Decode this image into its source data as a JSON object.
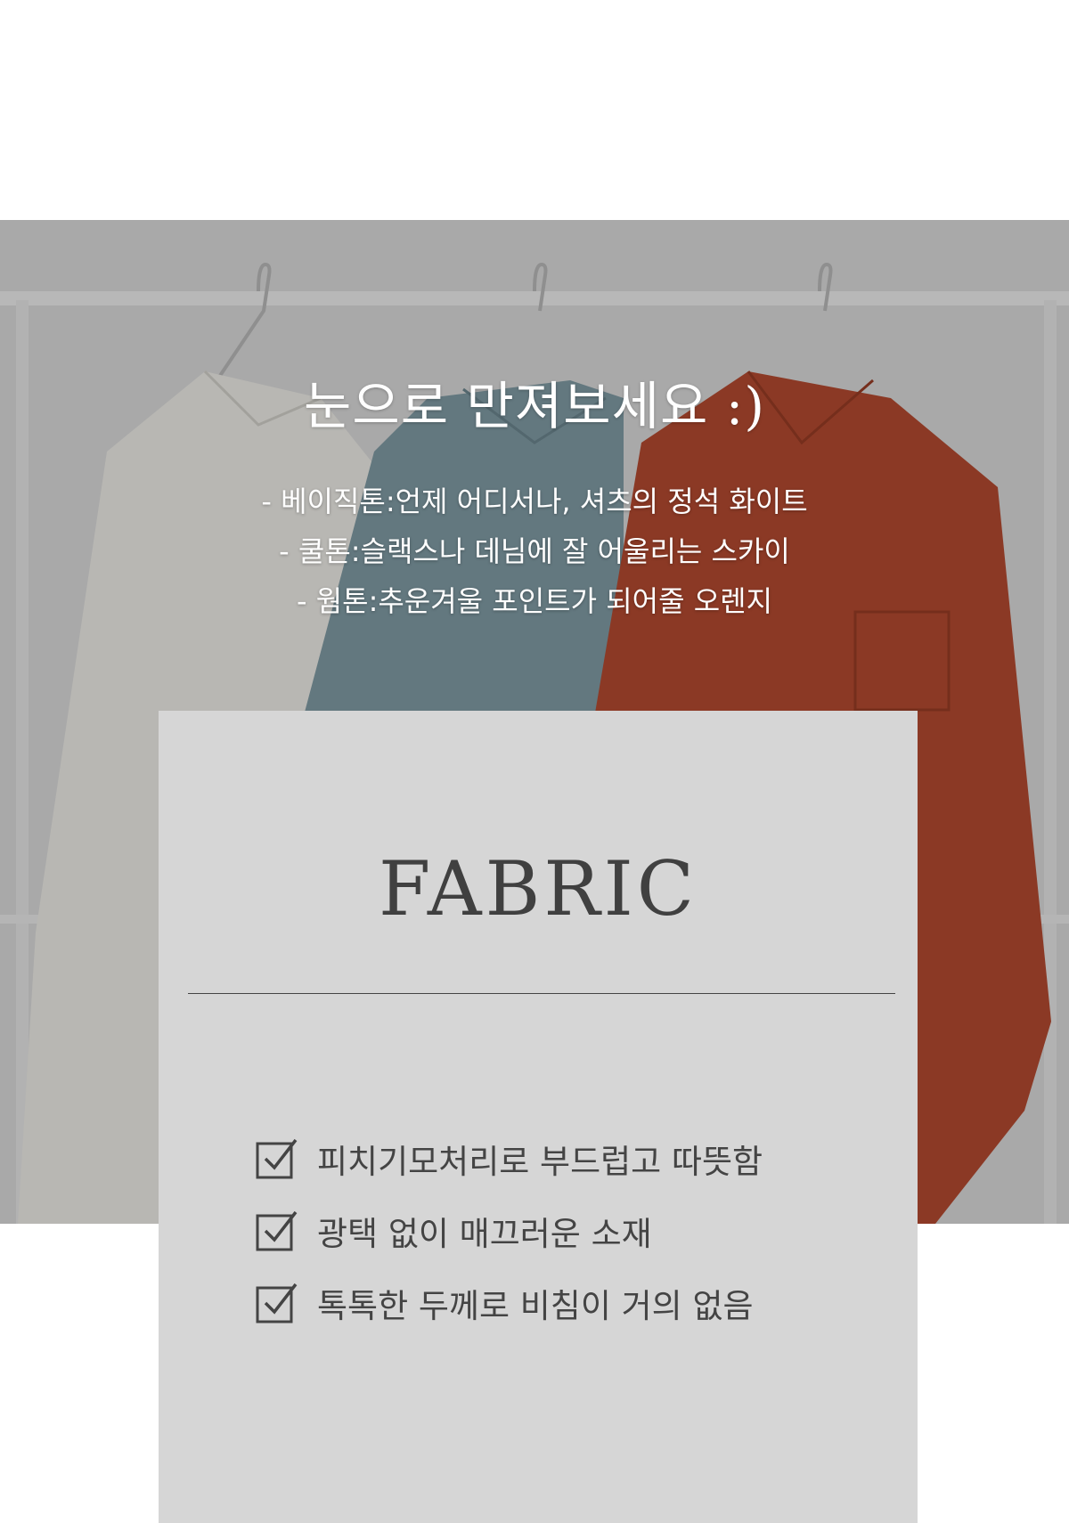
{
  "hero": {
    "title": "눈으로 만져보세요 :)",
    "lines": [
      "- 베이직톤:언제 어디서나, 셔츠의 정석 화이트",
      "- 쿨톤:슬랙스나 데님에 잘 어울리는 스카이",
      "- 웜톤:추운겨울 포인트가 되어줄 오렌지"
    ],
    "colors": {
      "white_shirt": "#ecebe6",
      "sky_shirt": "#7f9aa3",
      "orange_shirt": "#b34a30",
      "rack": "#e9e9e9",
      "overlay": "#000000"
    }
  },
  "card": {
    "title": "FABRIC",
    "background": "#d6d6d6",
    "features": [
      {
        "icon": "checkbox-checked-icon",
        "text": "피치기모처리로 부드럽고 따뜻함"
      },
      {
        "icon": "checkbox-checked-icon",
        "text": "광택 없이 매끄러운 소재"
      },
      {
        "icon": "checkbox-checked-icon",
        "text": "톡톡한 두께로 비침이 거의 없음"
      }
    ]
  }
}
